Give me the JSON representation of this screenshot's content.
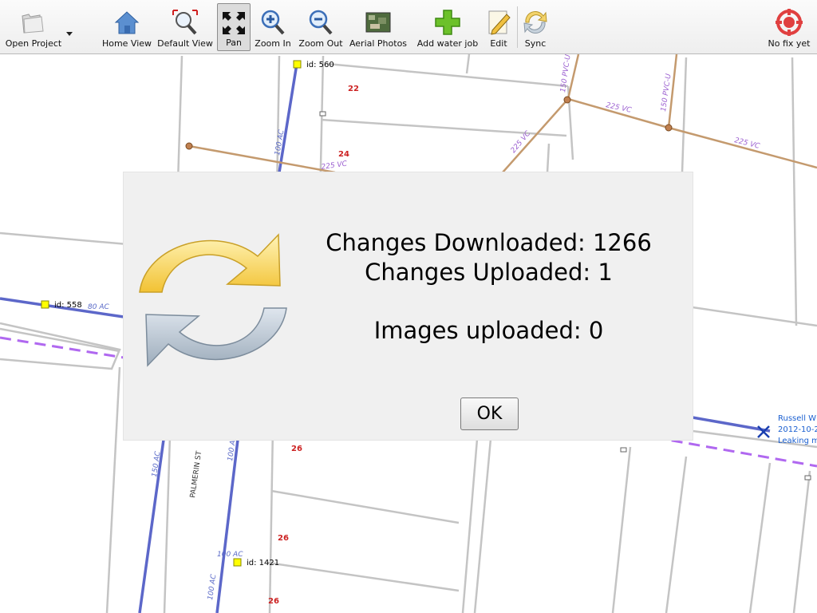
{
  "toolbar": {
    "open_project": "Open Project",
    "home_view": "Home View",
    "default_view": "Default View",
    "pan": "Pan",
    "zoom_in": "Zoom In",
    "zoom_out": "Zoom Out",
    "aerial_photos": "Aerial Photos",
    "add_water_job": "Add water job",
    "edit": "Edit",
    "sync": "Sync",
    "gps_status": "No fix yet"
  },
  "map": {
    "pipe_labels": [
      "100 AC",
      "225 VC",
      "150 PVC-U",
      "225 VC",
      "150 PVC-U",
      "225 VC",
      "225 VC",
      "80 AC",
      "150 AC",
      "100 AC",
      "100 AC",
      "100 AC"
    ],
    "parcel_numbers": [
      "22",
      "24",
      "26",
      "26",
      "26"
    ],
    "node_ids": [
      "id: 560",
      "id: 558",
      "id: 1421"
    ],
    "street_name": "PALMERIN ST",
    "job": {
      "name": "Russell W",
      "date": "2012-10-2",
      "issue": "Leaking m"
    }
  },
  "dialog": {
    "changes_downloaded": "Changes Downloaded: 1266",
    "changes_uploaded": "Changes Uploaded: 1",
    "images_uploaded": "Images uploaded: 0",
    "ok_label": "OK"
  },
  "colors": {
    "water_main": "#5c67c9",
    "sewer_main": "#c49a6e",
    "dashed_line": "#b068f0",
    "parcel_number": "#cc2222",
    "job_text": "#1a5fd0"
  }
}
